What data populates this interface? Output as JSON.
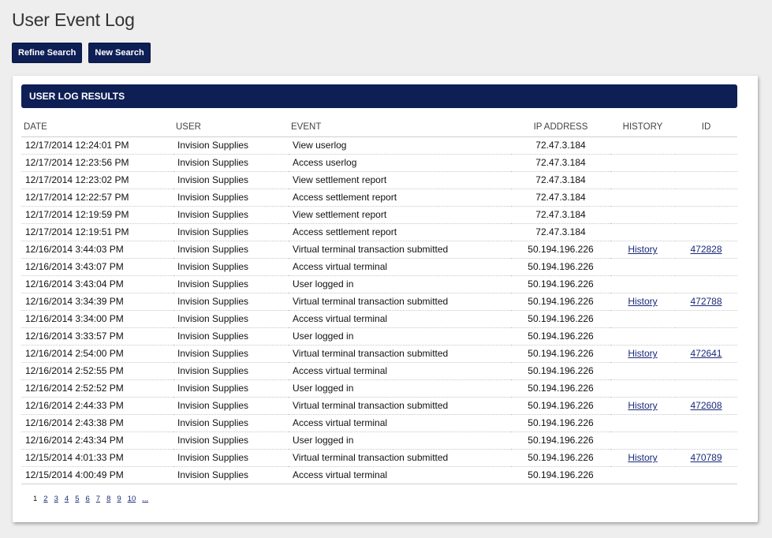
{
  "page": {
    "title": "User Event Log"
  },
  "toolbar": {
    "refine_label": "Refine Search",
    "new_label": "New Search"
  },
  "panel": {
    "header": "USER LOG RESULTS"
  },
  "table": {
    "columns": {
      "date": "DATE",
      "user": "USER",
      "event": "EVENT",
      "ip": "IP ADDRESS",
      "history": "HISTORY",
      "id": "ID"
    },
    "rows": [
      {
        "date": "12/17/2014 12:24:01 PM",
        "user": "Invision Supplies",
        "event": "View userlog",
        "ip": "72.47.3.184",
        "history": "",
        "id": ""
      },
      {
        "date": "12/17/2014 12:23:56 PM",
        "user": "Invision Supplies",
        "event": "Access userlog",
        "ip": "72.47.3.184",
        "history": "",
        "id": ""
      },
      {
        "date": "12/17/2014 12:23:02 PM",
        "user": "Invision Supplies",
        "event": "View settlement report",
        "ip": "72.47.3.184",
        "history": "",
        "id": ""
      },
      {
        "date": "12/17/2014 12:22:57 PM",
        "user": "Invision Supplies",
        "event": "Access settlement report",
        "ip": "72.47.3.184",
        "history": "",
        "id": ""
      },
      {
        "date": "12/17/2014 12:19:59 PM",
        "user": "Invision Supplies",
        "event": "View settlement report",
        "ip": "72.47.3.184",
        "history": "",
        "id": ""
      },
      {
        "date": "12/17/2014 12:19:51 PM",
        "user": "Invision Supplies",
        "event": "Access settlement report",
        "ip": "72.47.3.184",
        "history": "",
        "id": ""
      },
      {
        "date": "12/16/2014 3:44:03 PM",
        "user": "Invision Supplies",
        "event": "Virtual terminal transaction submitted",
        "ip": "50.194.196.226",
        "history": "History",
        "id": "472828"
      },
      {
        "date": "12/16/2014 3:43:07 PM",
        "user": "Invision Supplies",
        "event": "Access virtual terminal",
        "ip": "50.194.196.226",
        "history": "",
        "id": ""
      },
      {
        "date": "12/16/2014 3:43:04 PM",
        "user": "Invision Supplies",
        "event": "User logged in",
        "ip": "50.194.196.226",
        "history": "",
        "id": ""
      },
      {
        "date": "12/16/2014 3:34:39 PM",
        "user": "Invision Supplies",
        "event": "Virtual terminal transaction submitted",
        "ip": "50.194.196.226",
        "history": "History",
        "id": "472788"
      },
      {
        "date": "12/16/2014 3:34:00 PM",
        "user": "Invision Supplies",
        "event": "Access virtual terminal",
        "ip": "50.194.196.226",
        "history": "",
        "id": ""
      },
      {
        "date": "12/16/2014 3:33:57 PM",
        "user": "Invision Supplies",
        "event": "User logged in",
        "ip": "50.194.196.226",
        "history": "",
        "id": ""
      },
      {
        "date": "12/16/2014 2:54:00 PM",
        "user": "Invision Supplies",
        "event": "Virtual terminal transaction submitted",
        "ip": "50.194.196.226",
        "history": "History",
        "id": "472641"
      },
      {
        "date": "12/16/2014 2:52:55 PM",
        "user": "Invision Supplies",
        "event": "Access virtual terminal",
        "ip": "50.194.196.226",
        "history": "",
        "id": ""
      },
      {
        "date": "12/16/2014 2:52:52 PM",
        "user": "Invision Supplies",
        "event": "User logged in",
        "ip": "50.194.196.226",
        "history": "",
        "id": ""
      },
      {
        "date": "12/16/2014 2:44:33 PM",
        "user": "Invision Supplies",
        "event": "Virtual terminal transaction submitted",
        "ip": "50.194.196.226",
        "history": "History",
        "id": "472608"
      },
      {
        "date": "12/16/2014 2:43:38 PM",
        "user": "Invision Supplies",
        "event": "Access virtual terminal",
        "ip": "50.194.196.226",
        "history": "",
        "id": ""
      },
      {
        "date": "12/16/2014 2:43:34 PM",
        "user": "Invision Supplies",
        "event": "User logged in",
        "ip": "50.194.196.226",
        "history": "",
        "id": ""
      },
      {
        "date": "12/15/2014 4:01:33 PM",
        "user": "Invision Supplies",
        "event": "Virtual terminal transaction submitted",
        "ip": "50.194.196.226",
        "history": "History",
        "id": "470789"
      },
      {
        "date": "12/15/2014 4:00:49 PM",
        "user": "Invision Supplies",
        "event": "Access virtual terminal",
        "ip": "50.194.196.226",
        "history": "",
        "id": ""
      }
    ]
  },
  "pagination": {
    "current": "1",
    "pages": [
      "2",
      "3",
      "4",
      "5",
      "6",
      "7",
      "8",
      "9",
      "10",
      "..."
    ]
  },
  "colors": {
    "primary": "#0e1f56",
    "link": "#1a2a7a",
    "background": "#eeeeee"
  }
}
